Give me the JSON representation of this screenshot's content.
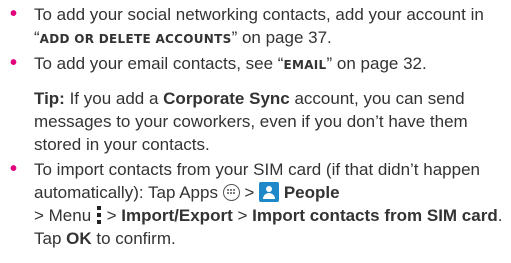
{
  "bullet_char": "•",
  "colors": {
    "bullet": "#e2007a",
    "text": "#333333",
    "people_icon": "#1e88c8"
  },
  "item1": {
    "t1": "To add your social networking contacts, add your account in ",
    "q1": "“",
    "link": "ADD OR DELETE ACCOUNTS",
    "q2": "”",
    "t2": " on page 37."
  },
  "item2": {
    "t1": "To add your email contacts, see ",
    "q1": "“",
    "link": "EMAIL",
    "q2": "”",
    "t2": " on page 32."
  },
  "tip": {
    "label": "Tip:",
    "t1": " If you add a ",
    "bold": "Corporate Sync",
    "t2": " account, you can send messages to your coworkers, even if you don’t have them stored in your contacts."
  },
  "item3": {
    "t1": "To import contacts from your SIM card (if that didn’t happen automatically): Tap Apps ",
    "apps_icon": "apps-icon",
    "sp": " ",
    "people_icon": "people-icon",
    "people": "People",
    "sep1": " > Menu ",
    "menu_icon": "menu-icon",
    "sep2": " > ",
    "import_export": "Import/Export",
    "sep3": " > ",
    "import_sim": "Import contacts from SIM card",
    "t2": ". Tap ",
    "ok": "OK",
    "t3": " to confirm."
  }
}
